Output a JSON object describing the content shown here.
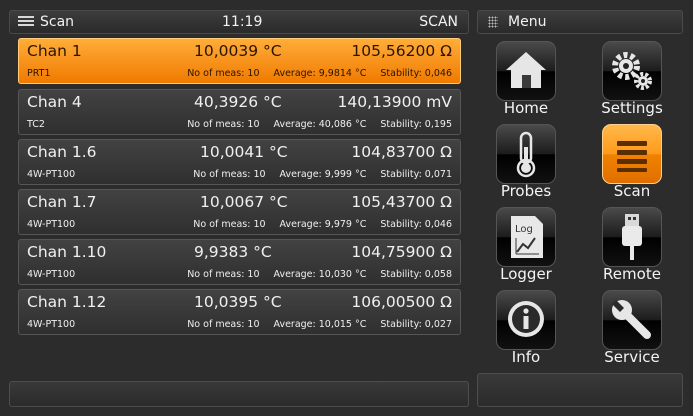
{
  "header": {
    "title": "Scan",
    "clock": "11:19",
    "mode": "SCAN"
  },
  "menu_header": {
    "title": "Menu"
  },
  "channels": [
    {
      "name": "Chan 1",
      "temp": "10,0039 °C",
      "value": "105,56200 Ω",
      "sensor": "PRT1",
      "meas": "No of meas: 10",
      "average": "Average: 9,9814 °C",
      "stability": "Stability: 0,046",
      "selected": true
    },
    {
      "name": "Chan 4",
      "temp": "40,3926 °C",
      "value": "140,13900 mV",
      "sensor": "TC2",
      "meas": "No of meas: 10",
      "average": "Average: 40,086 °C",
      "stability": "Stability: 0,195",
      "selected": false
    },
    {
      "name": "Chan 1.6",
      "temp": "10,0041 °C",
      "value": "104,83700 Ω",
      "sensor": "4W-PT100",
      "meas": "No of meas: 10",
      "average": "Average: 9,999 °C",
      "stability": "Stability: 0,071",
      "selected": false
    },
    {
      "name": "Chan 1.7",
      "temp": "10,0067 °C",
      "value": "105,43700 Ω",
      "sensor": "4W-PT100",
      "meas": "No of meas: 10",
      "average": "Average: 9,979 °C",
      "stability": "Stability: 0,046",
      "selected": false
    },
    {
      "name": "Chan 1.10",
      "temp": "9,9383 °C",
      "value": "104,75900 Ω",
      "sensor": "4W-PT100",
      "meas": "No of meas: 10",
      "average": "Average: 10,030 °C",
      "stability": "Stability: 0,058",
      "selected": false
    },
    {
      "name": "Chan 1.12",
      "temp": "10,0395 °C",
      "value": "106,00500 Ω",
      "sensor": "4W-PT100",
      "meas": "No of meas: 10",
      "average": "Average: 10,015 °C",
      "stability": "Stability: 0,027",
      "selected": false
    }
  ],
  "menu": [
    {
      "label": "Home",
      "icon": "home-icon"
    },
    {
      "label": "Settings",
      "icon": "gears-icon"
    },
    {
      "label": "Probes",
      "icon": "thermometer-icon"
    },
    {
      "label": "Scan",
      "icon": "scan-list-icon",
      "active": true
    },
    {
      "label": "Logger",
      "icon": "log-chart-icon",
      "icon_text": "Log"
    },
    {
      "label": "Remote",
      "icon": "usb-icon"
    },
    {
      "label": "Info",
      "icon": "info-icon"
    },
    {
      "label": "Service",
      "icon": "wrench-icon"
    }
  ],
  "colors": {
    "accent": "#ff9a1a",
    "background": "#2c2c2c"
  }
}
